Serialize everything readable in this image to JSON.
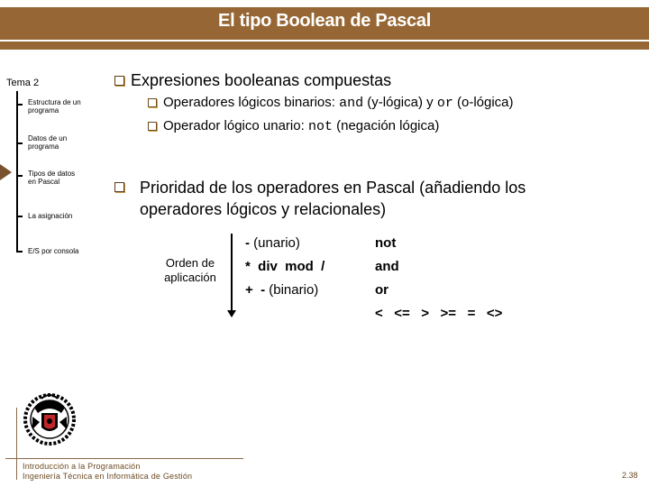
{
  "header": {
    "title": "El tipo Boolean de Pascal"
  },
  "sidebar": {
    "title": "Tema 2",
    "items": [
      {
        "label": "Estructura de un programa"
      },
      {
        "label": "Datos de un programa"
      },
      {
        "label": "Tipos de datos en Pascal",
        "current": true
      },
      {
        "label": "La asignación"
      },
      {
        "label": "E/S por consola"
      }
    ]
  },
  "content": {
    "section1": {
      "title": "Expresiones booleanas compuestas",
      "sub1": {
        "prefix": "Operadores lógicos binarios: ",
        "code1": "and",
        "mid1": " (y-lógica) y ",
        "code2": "or",
        "suffix": " (o-lógica)"
      },
      "sub2": {
        "prefix": "Operador lógico unario: ",
        "code1": "not",
        "suffix": " (negación lógica)"
      }
    },
    "section2": {
      "line1": "Prioridad de los operadores en Pascal (añadiendo los",
      "line2": "operadores lógicos y relacionales)"
    },
    "precedence": {
      "order_label_1": "Orden de",
      "order_label_2": "aplicación",
      "col1": [
        {
          "a": "- ",
          "b": "(unario)"
        },
        {
          "a": "*  div  mod  /"
        },
        {
          "a": "+  - ",
          "b": "(binario)"
        }
      ],
      "col2": [
        "not",
        "and",
        "or",
        "<   <=   >   >=   =   <>"
      ]
    }
  },
  "footer": {
    "line1": "Introducción a la Programación",
    "line2": "Ingeniería Técnica en Informática de Gestión",
    "page": "2.38"
  },
  "colors": {
    "brand": "#966734",
    "footer_text": "#6b4a20"
  }
}
